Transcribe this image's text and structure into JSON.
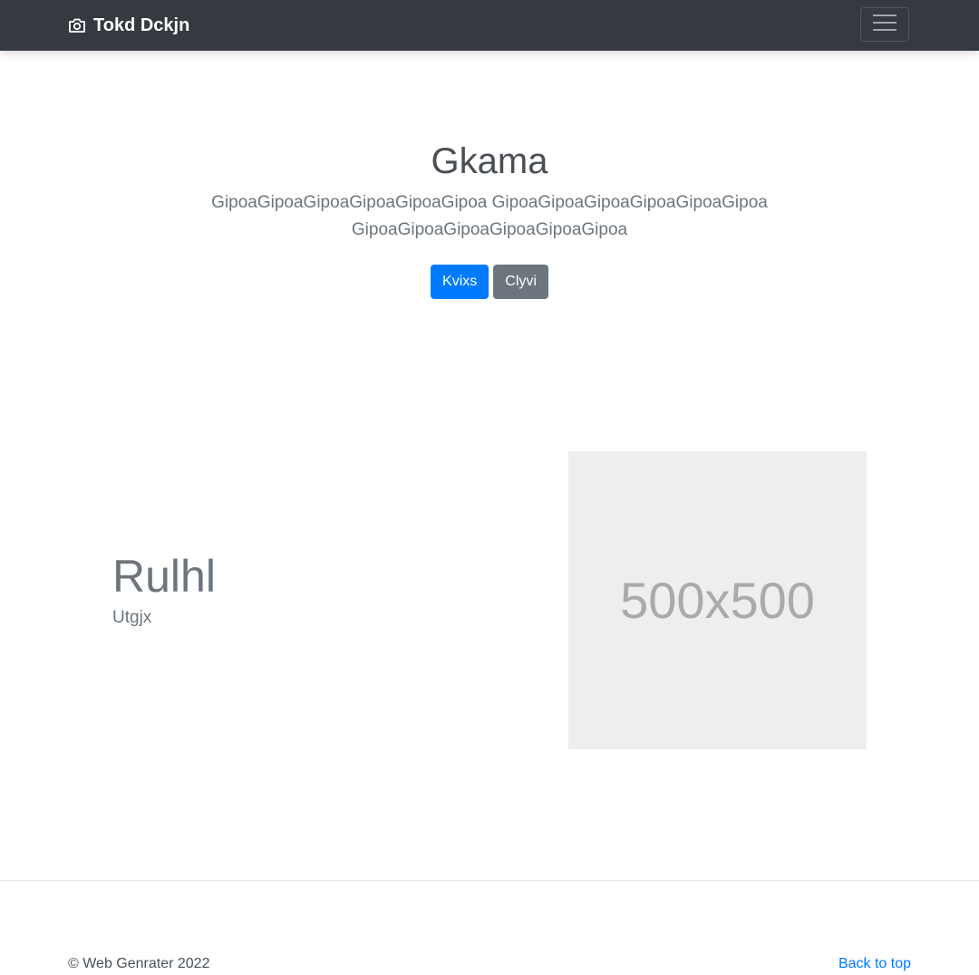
{
  "navbar": {
    "brand_text": "Tokd Dckjn",
    "brand_icon": "camera-icon",
    "toggler_icon": "hamburger-menu-icon"
  },
  "hero": {
    "title": "Gkama",
    "lead": "GipoaGipoaGipoaGipoaGipoaGipoa GipoaGipoaGipoaGipoaGipoaGipoa GipoaGipoaGipoaGipoaGipoaGipoa",
    "primary_button": "Kvixs",
    "secondary_button": "Clyvi"
  },
  "feature": {
    "heading": "Rulhl",
    "subheading": "Utgjx",
    "image_placeholder": "500x500"
  },
  "footer": {
    "copyright": "© Web Genrater 2022",
    "back_to_top": "Back to top"
  },
  "colors": {
    "navbar_bg": "#343a40",
    "primary": "#007bff",
    "secondary": "#6c757d",
    "placeholder_bg": "#eeeeee"
  }
}
